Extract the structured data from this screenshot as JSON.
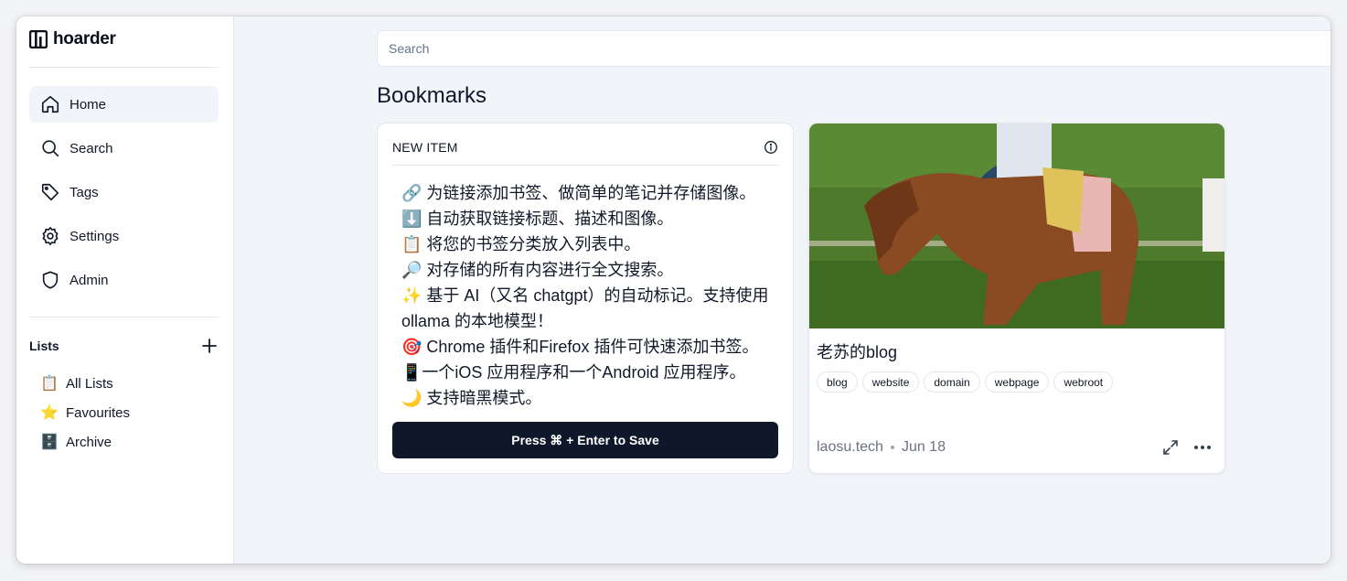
{
  "app": {
    "name": "hoarder"
  },
  "sidebar": {
    "nav": [
      {
        "label": "Home",
        "icon": "home-icon",
        "active": true
      },
      {
        "label": "Search",
        "icon": "search-icon"
      },
      {
        "label": "Tags",
        "icon": "tag-icon"
      },
      {
        "label": "Settings",
        "icon": "gear-icon"
      },
      {
        "label": "Admin",
        "icon": "shield-icon"
      }
    ],
    "lists_title": "Lists",
    "lists": [
      {
        "emoji": "📋",
        "label": "All Lists"
      },
      {
        "emoji": "⭐️",
        "label": "Favourites"
      },
      {
        "emoji": "🗄️",
        "label": "Archive"
      }
    ]
  },
  "search": {
    "placeholder": "Search"
  },
  "main": {
    "title": "Bookmarks"
  },
  "new_item": {
    "title": "NEW ITEM",
    "lines": [
      "🔗 为链接添加书签、做简单的笔记并存储图像。",
      "⬇️ 自动获取链接标题、描述和图像。",
      "📋 将您的书签分类放入列表中。",
      "🔎 对存储的所有内容进行全文搜索。",
      "✨ 基于 AI（又名 chatgpt）的自动标记。支持使用 ollama 的本地模型！",
      "🎯 Chrome 插件和Firefox 插件可快速添加书签。",
      "📱一个iOS 应用程序和一个Android 应用程序。",
      "🌙 支持暗黑模式。"
    ],
    "save_label": "Press ⌘ + Enter to Save"
  },
  "bookmark": {
    "title": "老苏的blog",
    "tags": [
      "blog",
      "website",
      "domain",
      "webpage",
      "webroot"
    ],
    "domain": "laosu.tech",
    "date": "Jun 18"
  },
  "colors": {
    "accent": "#0f172a",
    "background": "#f1f5f9"
  }
}
